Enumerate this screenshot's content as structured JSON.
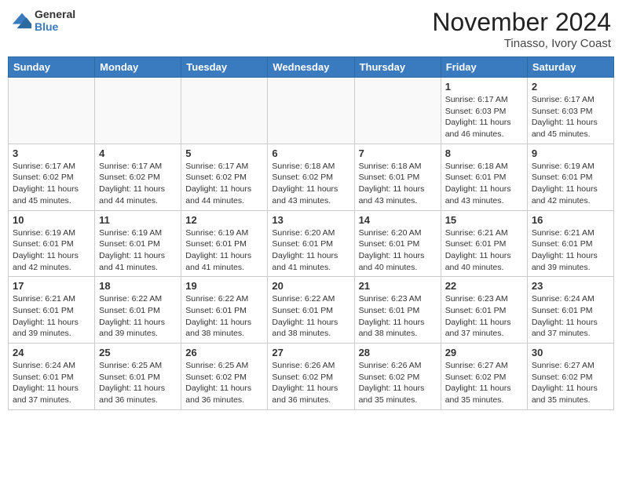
{
  "header": {
    "logo_general": "General",
    "logo_blue": "Blue",
    "month_title": "November 2024",
    "location": "Tinasso, Ivory Coast"
  },
  "weekdays": [
    "Sunday",
    "Monday",
    "Tuesday",
    "Wednesday",
    "Thursday",
    "Friday",
    "Saturday"
  ],
  "weeks": [
    [
      {
        "day": "",
        "info": ""
      },
      {
        "day": "",
        "info": ""
      },
      {
        "day": "",
        "info": ""
      },
      {
        "day": "",
        "info": ""
      },
      {
        "day": "",
        "info": ""
      },
      {
        "day": "1",
        "info": "Sunrise: 6:17 AM\nSunset: 6:03 PM\nDaylight: 11 hours\nand 46 minutes."
      },
      {
        "day": "2",
        "info": "Sunrise: 6:17 AM\nSunset: 6:03 PM\nDaylight: 11 hours\nand 45 minutes."
      }
    ],
    [
      {
        "day": "3",
        "info": "Sunrise: 6:17 AM\nSunset: 6:02 PM\nDaylight: 11 hours\nand 45 minutes."
      },
      {
        "day": "4",
        "info": "Sunrise: 6:17 AM\nSunset: 6:02 PM\nDaylight: 11 hours\nand 44 minutes."
      },
      {
        "day": "5",
        "info": "Sunrise: 6:17 AM\nSunset: 6:02 PM\nDaylight: 11 hours\nand 44 minutes."
      },
      {
        "day": "6",
        "info": "Sunrise: 6:18 AM\nSunset: 6:02 PM\nDaylight: 11 hours\nand 43 minutes."
      },
      {
        "day": "7",
        "info": "Sunrise: 6:18 AM\nSunset: 6:01 PM\nDaylight: 11 hours\nand 43 minutes."
      },
      {
        "day": "8",
        "info": "Sunrise: 6:18 AM\nSunset: 6:01 PM\nDaylight: 11 hours\nand 43 minutes."
      },
      {
        "day": "9",
        "info": "Sunrise: 6:19 AM\nSunset: 6:01 PM\nDaylight: 11 hours\nand 42 minutes."
      }
    ],
    [
      {
        "day": "10",
        "info": "Sunrise: 6:19 AM\nSunset: 6:01 PM\nDaylight: 11 hours\nand 42 minutes."
      },
      {
        "day": "11",
        "info": "Sunrise: 6:19 AM\nSunset: 6:01 PM\nDaylight: 11 hours\nand 41 minutes."
      },
      {
        "day": "12",
        "info": "Sunrise: 6:19 AM\nSunset: 6:01 PM\nDaylight: 11 hours\nand 41 minutes."
      },
      {
        "day": "13",
        "info": "Sunrise: 6:20 AM\nSunset: 6:01 PM\nDaylight: 11 hours\nand 41 minutes."
      },
      {
        "day": "14",
        "info": "Sunrise: 6:20 AM\nSunset: 6:01 PM\nDaylight: 11 hours\nand 40 minutes."
      },
      {
        "day": "15",
        "info": "Sunrise: 6:21 AM\nSunset: 6:01 PM\nDaylight: 11 hours\nand 40 minutes."
      },
      {
        "day": "16",
        "info": "Sunrise: 6:21 AM\nSunset: 6:01 PM\nDaylight: 11 hours\nand 39 minutes."
      }
    ],
    [
      {
        "day": "17",
        "info": "Sunrise: 6:21 AM\nSunset: 6:01 PM\nDaylight: 11 hours\nand 39 minutes."
      },
      {
        "day": "18",
        "info": "Sunrise: 6:22 AM\nSunset: 6:01 PM\nDaylight: 11 hours\nand 39 minutes."
      },
      {
        "day": "19",
        "info": "Sunrise: 6:22 AM\nSunset: 6:01 PM\nDaylight: 11 hours\nand 38 minutes."
      },
      {
        "day": "20",
        "info": "Sunrise: 6:22 AM\nSunset: 6:01 PM\nDaylight: 11 hours\nand 38 minutes."
      },
      {
        "day": "21",
        "info": "Sunrise: 6:23 AM\nSunset: 6:01 PM\nDaylight: 11 hours\nand 38 minutes."
      },
      {
        "day": "22",
        "info": "Sunrise: 6:23 AM\nSunset: 6:01 PM\nDaylight: 11 hours\nand 37 minutes."
      },
      {
        "day": "23",
        "info": "Sunrise: 6:24 AM\nSunset: 6:01 PM\nDaylight: 11 hours\nand 37 minutes."
      }
    ],
    [
      {
        "day": "24",
        "info": "Sunrise: 6:24 AM\nSunset: 6:01 PM\nDaylight: 11 hours\nand 37 minutes."
      },
      {
        "day": "25",
        "info": "Sunrise: 6:25 AM\nSunset: 6:01 PM\nDaylight: 11 hours\nand 36 minutes."
      },
      {
        "day": "26",
        "info": "Sunrise: 6:25 AM\nSunset: 6:02 PM\nDaylight: 11 hours\nand 36 minutes."
      },
      {
        "day": "27",
        "info": "Sunrise: 6:26 AM\nSunset: 6:02 PM\nDaylight: 11 hours\nand 36 minutes."
      },
      {
        "day": "28",
        "info": "Sunrise: 6:26 AM\nSunset: 6:02 PM\nDaylight: 11 hours\nand 35 minutes."
      },
      {
        "day": "29",
        "info": "Sunrise: 6:27 AM\nSunset: 6:02 PM\nDaylight: 11 hours\nand 35 minutes."
      },
      {
        "day": "30",
        "info": "Sunrise: 6:27 AM\nSunset: 6:02 PM\nDaylight: 11 hours\nand 35 minutes."
      }
    ]
  ]
}
